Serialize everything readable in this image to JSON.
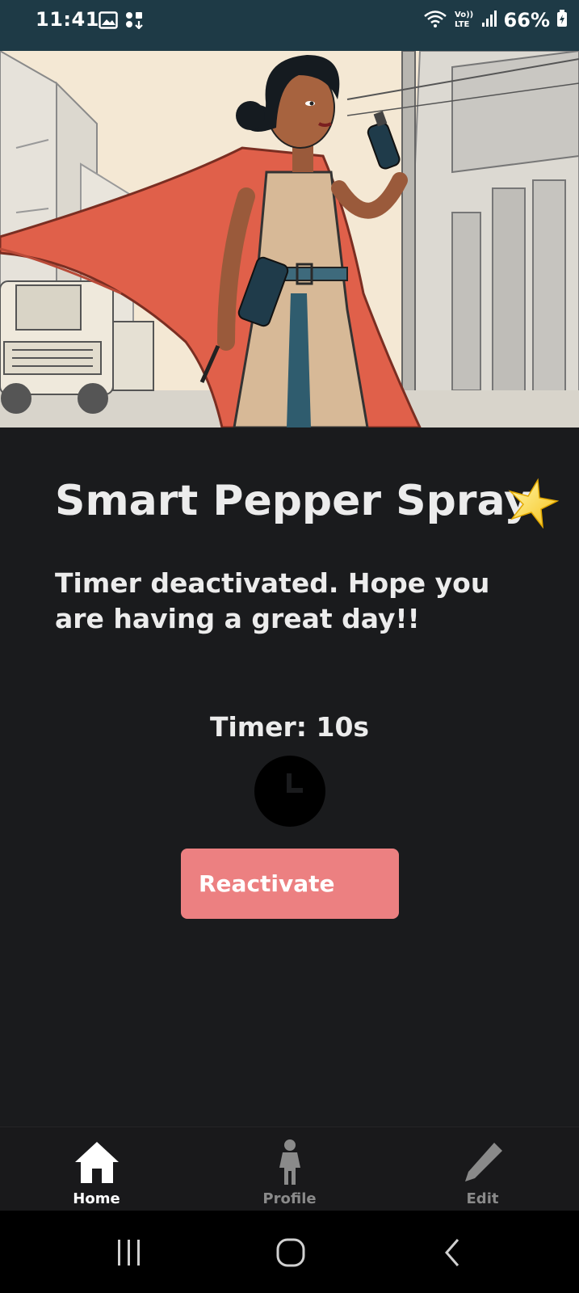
{
  "status_bar": {
    "time": "11:41",
    "battery_percent": "66%",
    "network_label": "Vo)) LTE",
    "icons": [
      "gallery-icon",
      "apps-icon",
      "wifi-icon",
      "volte-icon",
      "signal-icon",
      "battery-icon"
    ]
  },
  "hero": {
    "image_name": "superhero-woman-with-pepper-spray-illustration"
  },
  "main": {
    "title": "Smart Pepper Spray",
    "title_emoji": "star",
    "message": "Timer deactivated. Hope you are having a great day!!",
    "timer_label": "Timer: 10s",
    "timer_icon": "clock-icon",
    "reactivate_label": "Reactivate"
  },
  "bottom_nav": {
    "items": [
      {
        "label": "Home",
        "icon": "home-icon",
        "active": true
      },
      {
        "label": "Profile",
        "icon": "person-icon",
        "active": false
      },
      {
        "label": "Edit",
        "icon": "pencil-icon",
        "active": false
      }
    ]
  },
  "system_nav": {
    "buttons": [
      "recent-apps",
      "home",
      "back"
    ]
  },
  "colors": {
    "status_bar_bg": "#1e3a46",
    "app_bg": "#1a1b1d",
    "accent_button": "#ec8081",
    "text_primary": "#ececec",
    "nav_inactive": "#8a8a8a"
  }
}
